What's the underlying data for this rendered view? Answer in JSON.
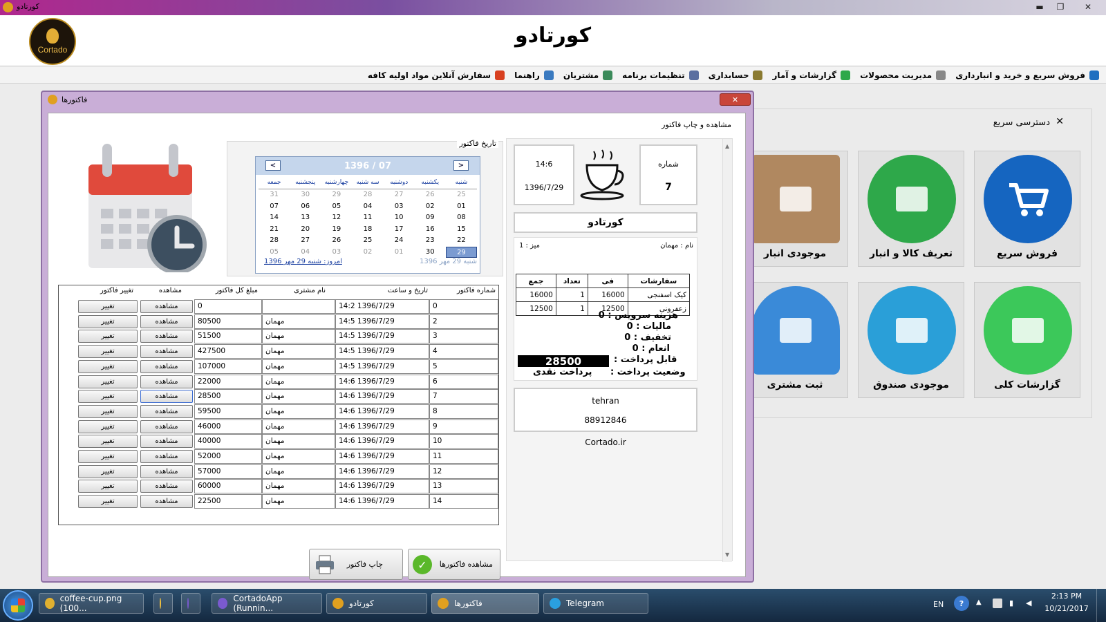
{
  "window": {
    "title": "کورتادو",
    "min": "▬",
    "max": "❐",
    "close": "✕"
  },
  "header": {
    "app_name": "کورتادو",
    "logo_text": "Cortado"
  },
  "menu": [
    {
      "label": "فروش سریع و خرید و انبارداری",
      "color": "#1f6fc0"
    },
    {
      "label": "مدیریت محصولات",
      "color": "#888"
    },
    {
      "label": "گزارشات و آمار",
      "color": "#2ea84a"
    },
    {
      "label": "حسابداری",
      "color": "#8a7a30"
    },
    {
      "label": "تنظیمات برنامه",
      "color": "#5b6fa0"
    },
    {
      "label": "مشتریان",
      "color": "#3a8a5a"
    },
    {
      "label": "راهنما",
      "color": "#3a7ac0"
    },
    {
      "label": "سفارش آنلاین مواد اولیه کافه",
      "color": "#d84020"
    }
  ],
  "quick_access": {
    "title": "دسترسی سریع",
    "close": "✕",
    "tiles": [
      {
        "label": "فروش سریع",
        "color": "#1565c0"
      },
      {
        "label": "تعریف کالا و انبار",
        "color": "#2ea84a"
      },
      {
        "label": "موجودی انبار",
        "color": "#b08860"
      },
      {
        "label": "گزارشات کلی",
        "color": "#3cc85a"
      },
      {
        "label": "موجودی صندوق",
        "color": "#2a9fd8"
      },
      {
        "label": "ثبت مشتری",
        "color": "#3a8ad8"
      }
    ]
  },
  "invoice_window": {
    "title": "فاکتورها",
    "close": "✕",
    "section": "مشاهده و چاپ فاکتور",
    "calendar": {
      "label": "تاریخ فاکتور",
      "month": "1396 / 07",
      "prev": "<",
      "next": ">",
      "weekdays": [
        "شنبه",
        "یکشنبه",
        "دوشنبه",
        "سه شنبه",
        "چهارشنبه",
        "پنجشنبه",
        "جمعه"
      ],
      "weeks": [
        [
          "25",
          "26",
          "27",
          "28",
          "29",
          "30",
          "31"
        ],
        [
          "01",
          "02",
          "03",
          "04",
          "05",
          "06",
          "07"
        ],
        [
          "08",
          "09",
          "10",
          "11",
          "12",
          "13",
          "14"
        ],
        [
          "15",
          "16",
          "17",
          "18",
          "19",
          "20",
          "21"
        ],
        [
          "22",
          "23",
          "24",
          "25",
          "26",
          "27",
          "28"
        ],
        [
          "29",
          "30",
          "01",
          "02",
          "03",
          "04",
          "05"
        ]
      ],
      "selected_day": "29",
      "today": "امروز: شنبه 29 مهر 1396",
      "selected_text": "شنبه 29 مهر 1396"
    },
    "table": {
      "headers": {
        "number": "شماره فاکتور",
        "datetime": "تاریخ و ساعت",
        "customer": "نام مشتری",
        "total": "مبلغ کل فاکتور",
        "view": "مشاهده",
        "edit": "تغییر فاکتور"
      },
      "view_label": "مشاهده",
      "edit_label": "تغییر",
      "rows": [
        {
          "num": "0",
          "date": "1396/7/29",
          "time": "14:2",
          "customer": "",
          "total": "0"
        },
        {
          "num": "2",
          "date": "1396/7/29",
          "time": "14:5",
          "customer": "مهمان",
          "total": "80500"
        },
        {
          "num": "3",
          "date": "1396/7/29",
          "time": "14:5",
          "customer": "مهمان",
          "total": "51500"
        },
        {
          "num": "4",
          "date": "1396/7/29",
          "time": "14:5",
          "customer": "مهمان",
          "total": "427500"
        },
        {
          "num": "5",
          "date": "1396/7/29",
          "time": "14:5",
          "customer": "مهمان",
          "total": "107000"
        },
        {
          "num": "6",
          "date": "1396/7/29",
          "time": "14:6",
          "customer": "مهمان",
          "total": "22000"
        },
        {
          "num": "7",
          "date": "1396/7/29",
          "time": "14:6",
          "customer": "مهمان",
          "total": "28500"
        },
        {
          "num": "8",
          "date": "1396/7/29",
          "time": "14:6",
          "customer": "مهمان",
          "total": "59500"
        },
        {
          "num": "9",
          "date": "1396/7/29",
          "time": "14:6",
          "customer": "مهمان",
          "total": "46000"
        },
        {
          "num": "10",
          "date": "1396/7/29",
          "time": "14:6",
          "customer": "مهمان",
          "total": "40000"
        },
        {
          "num": "11",
          "date": "1396/7/29",
          "time": "14:6",
          "customer": "مهمان",
          "total": "52000"
        },
        {
          "num": "12",
          "date": "1396/7/29",
          "time": "14:6",
          "customer": "مهمان",
          "total": "57000"
        },
        {
          "num": "13",
          "date": "1396/7/29",
          "time": "14:6",
          "customer": "مهمان",
          "total": "60000"
        },
        {
          "num": "14",
          "date": "1396/7/29",
          "time": "14:6",
          "customer": "مهمان",
          "total": "22500"
        }
      ]
    },
    "buttons": {
      "view_invoices": "مشاهده فاکتورها",
      "print_invoice": "چاپ فاکتور"
    },
    "receipt": {
      "number_label": "شماره",
      "number": "7",
      "time": "14:6",
      "date": "1396/7/29",
      "shop_name": "کورتادو",
      "name_label": "نام : مهمان",
      "table_label": "میز : 1",
      "order_headers": [
        "سفارشات",
        "فی",
        "تعداد",
        "جمع"
      ],
      "orders": [
        {
          "item": "کیک اسفنجی",
          "price": "16000",
          "qty": "1",
          "sum": "16000"
        },
        {
          "item": "زعفرونی",
          "price": "12500",
          "qty": "1",
          "sum": "12500"
        }
      ],
      "service_label": "هزینه سرویس :",
      "service": "0",
      "tax_label": "مالیات :",
      "tax": "0",
      "discount_label": "تخفیف :",
      "discount": "0",
      "tip_label": "انعام :",
      "tip": "0",
      "payable_label": "قابل پرداخت :",
      "payable": "28500",
      "status_label": "وضعیت پرداخت :",
      "status": "پرداخت نقدی",
      "city": "tehran",
      "phone": "88912846",
      "website": "Cortado.ir"
    }
  },
  "taskbar": {
    "items": [
      {
        "label": "coffee-cup.png (100...",
        "color": "#e0b030"
      },
      {
        "label": "",
        "color": "#f0c040"
      },
      {
        "label": "",
        "color": "#7a5acf"
      },
      {
        "label": "CortadoApp (Runnin...",
        "color": "#7a5acf"
      },
      {
        "label": "کورتادو",
        "color": "#e0a020"
      },
      {
        "label": "فاکتورها",
        "color": "#e0a020"
      },
      {
        "label": "Telegram",
        "color": "#2aa0e0"
      }
    ],
    "lang": "EN",
    "time": "2:13 PM",
    "date": "10/21/2017"
  }
}
